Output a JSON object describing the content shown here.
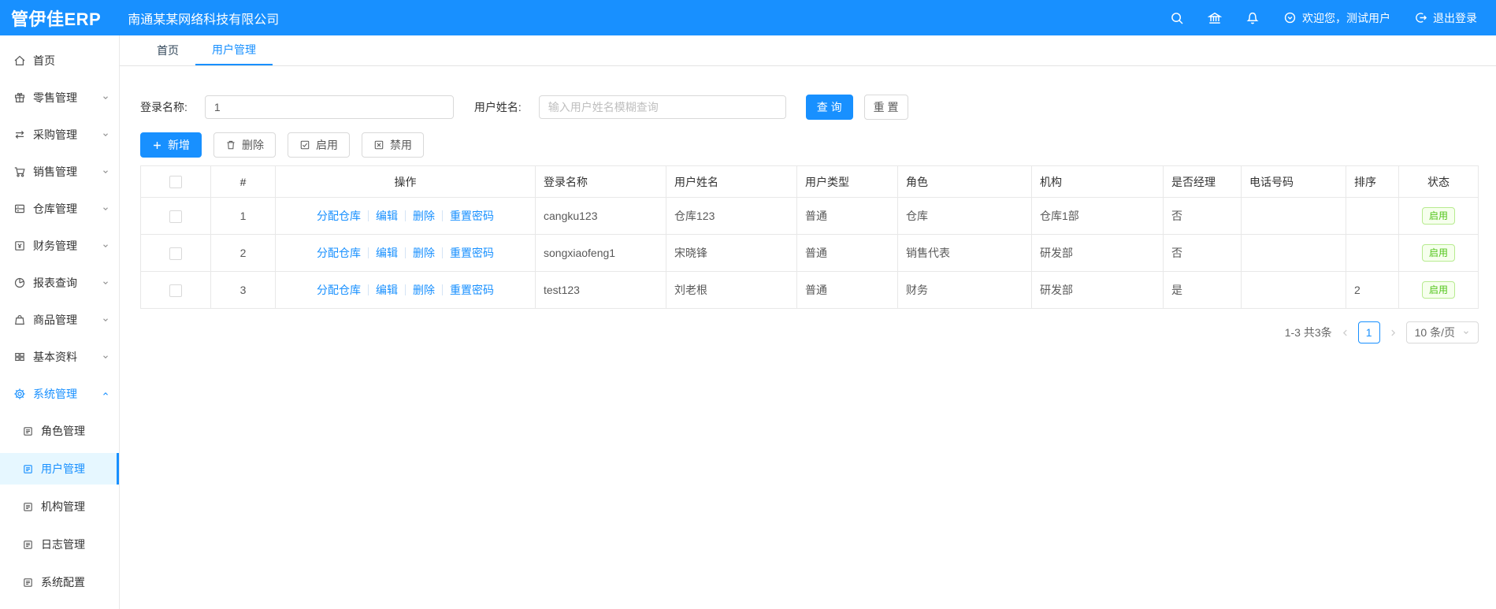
{
  "colors": {
    "primary": "#1890ff",
    "active_item_bg": "#e6f7ff",
    "status_green": "#52c41a",
    "status_border": "#b7eb8f",
    "status_bg": "#f6ffed"
  },
  "topbar": {
    "logo": "管伊佳ERP",
    "company": "南通某某网络科技有限公司",
    "welcome": "欢迎您，测试用户",
    "logout": "退出登录"
  },
  "tabs": {
    "home": "首页",
    "current": "用户管理"
  },
  "sidebar": {
    "items": [
      {
        "label": "首页"
      },
      {
        "label": "零售管理"
      },
      {
        "label": "采购管理"
      },
      {
        "label": "销售管理"
      },
      {
        "label": "仓库管理"
      },
      {
        "label": "财务管理"
      },
      {
        "label": "报表查询"
      },
      {
        "label": "商品管理"
      },
      {
        "label": "基本资料"
      },
      {
        "label": "系统管理"
      }
    ],
    "system_children": [
      {
        "label": "角色管理"
      },
      {
        "label": "用户管理"
      },
      {
        "label": "机构管理"
      },
      {
        "label": "日志管理"
      },
      {
        "label": "系统配置"
      }
    ]
  },
  "filter": {
    "login_label": "登录名称:",
    "login_value": "1",
    "name_label": "用户姓名:",
    "name_placeholder": "输入用户姓名模糊查询",
    "search_button": "查 询",
    "reset_button": "重 置"
  },
  "toolbar": {
    "add": "新增",
    "delete": "删除",
    "enable": "启用",
    "disable": "禁用"
  },
  "table": {
    "headers": {
      "index": "#",
      "actions": "操作",
      "login": "登录名称",
      "name": "用户姓名",
      "type": "用户类型",
      "role": "角色",
      "org": "机构",
      "manager": "是否经理",
      "phone": "电话号码",
      "sort": "排序",
      "status": "状态"
    },
    "action_links": [
      "分配仓库",
      "编辑",
      "删除",
      "重置密码"
    ],
    "rows": [
      {
        "index": "1",
        "login": "cangku123",
        "name": "仓库123",
        "type": "普通",
        "role": "仓库",
        "org": "仓库1部",
        "manager": "否",
        "phone": "",
        "sort": "",
        "status": "启用"
      },
      {
        "index": "2",
        "login": "songxiaofeng1",
        "name": "宋晓锋",
        "type": "普通",
        "role": "销售代表",
        "org": "研发部",
        "manager": "否",
        "phone": "",
        "sort": "",
        "status": "启用"
      },
      {
        "index": "3",
        "login": "test123",
        "name": "刘老根",
        "type": "普通",
        "role": "财务",
        "org": "研发部",
        "manager": "是",
        "phone": "",
        "sort": "2",
        "status": "启用"
      }
    ]
  },
  "pagination": {
    "total": "1-3 共3条",
    "page": "1",
    "page_size": "10 条/页"
  }
}
